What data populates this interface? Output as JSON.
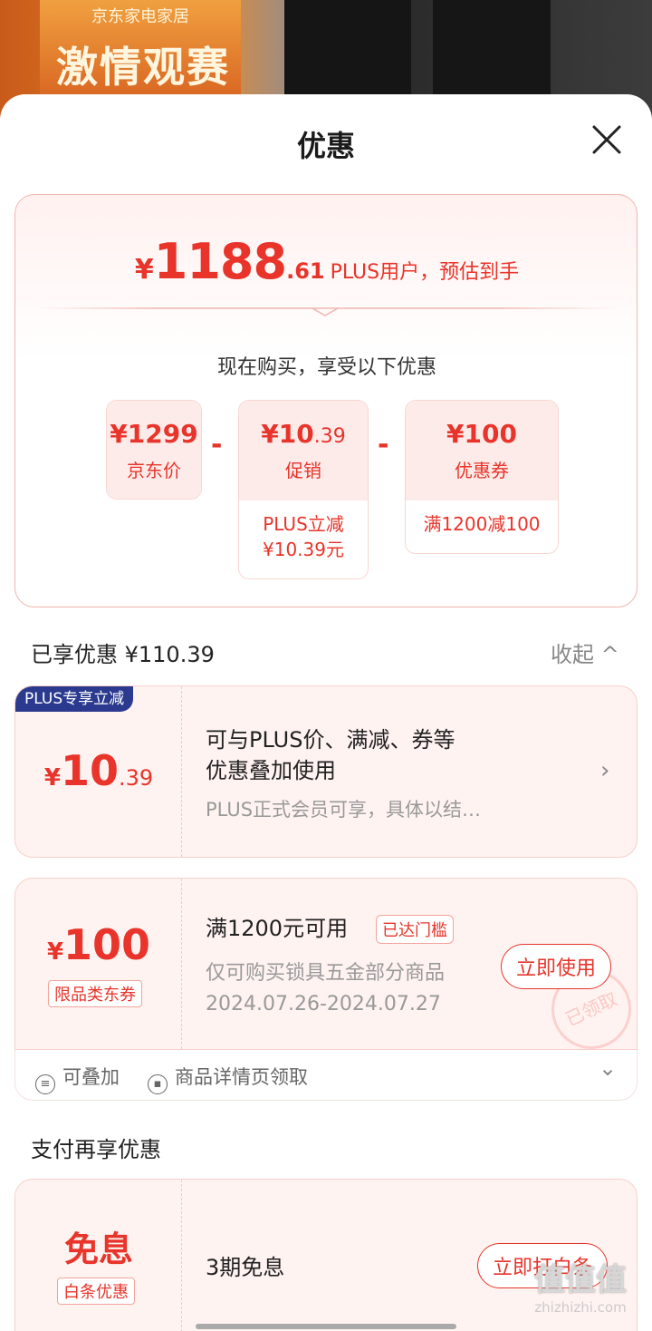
{
  "background": {
    "promo_top": "京东家电家居",
    "promo_title": "激情观赛"
  },
  "sheet": {
    "title": "优惠"
  },
  "summary": {
    "yen": "¥",
    "price_int": "1188",
    "price_dec": ".61",
    "note": "PLUS用户，预估到手",
    "subhead": "现在购买，享受以下优惠",
    "boxes": [
      {
        "amount": "¥1299",
        "label": "京东价",
        "detail": ""
      },
      {
        "amount_main": "¥10",
        "amount_dec": ".39",
        "label": "促销",
        "detail1": "PLUS立减",
        "detail2": "¥10.39元"
      },
      {
        "amount": "¥100",
        "label": "优惠券",
        "detail1": "满1200减100"
      }
    ],
    "minus": "-"
  },
  "enjoyed": {
    "title": "已享优惠 ¥110.39",
    "collapse_label": "收起 ^"
  },
  "coupon_plus": {
    "tag": "PLUS专享立减",
    "yen": "¥",
    "amount_int": "10",
    "amount_dec": ".39",
    "line1": "可与PLUS价、满减、券等",
    "line2": "优惠叠加使用",
    "sub": "PLUS正式会员可享，具体以结…",
    "chevron": "›"
  },
  "coupon_100": {
    "yen": "¥",
    "amount": "100",
    "type_label": "限品类东券",
    "title": "满1200元可用",
    "badge": "已达门槛",
    "desc": "仅可购买锁具五金部分商品",
    "period": "2024.07.26-2024.07.27",
    "button": "立即使用",
    "stamp": "已领取",
    "foot_stack": "可叠加",
    "foot_stack_icon": "≡",
    "foot_source": "商品详情页领取",
    "foot_source_icon": "▪",
    "chevron": "⌄"
  },
  "pay": {
    "title": "支付再享优惠",
    "amount": "免息",
    "type_label": "白条优惠",
    "desc": "3期免息",
    "button": "立即打白条"
  },
  "watermark": {
    "big": "值值值",
    "small": "zhizhizhi.com"
  },
  "colors": {
    "accent": "#e8342a",
    "plus_tag": "#2b3a8f",
    "card_bg": "#fff3f1"
  }
}
